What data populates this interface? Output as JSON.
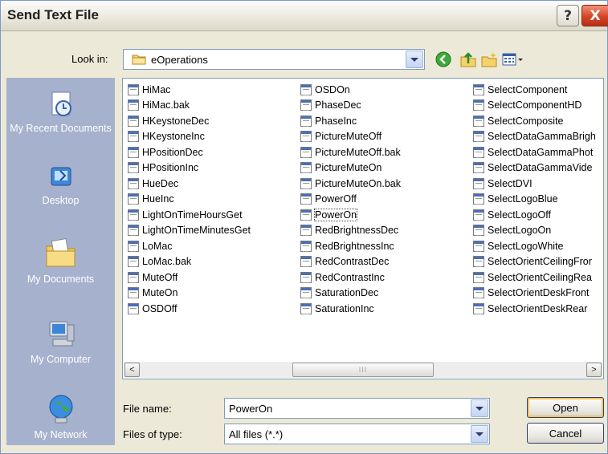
{
  "window": {
    "title": "Send Text File",
    "help_label": "?",
    "close_label": "X"
  },
  "lookin": {
    "label": "Look in:",
    "value": "eOperations"
  },
  "toolbar_icons": [
    "back-icon",
    "up-folder-icon",
    "new-folder-icon",
    "view-menu-icon"
  ],
  "places": [
    {
      "label": "My Recent Documents",
      "icon": "recent-documents-icon"
    },
    {
      "label": "Desktop",
      "icon": "desktop-icon"
    },
    {
      "label": "My Documents",
      "icon": "my-documents-icon"
    },
    {
      "label": "My Computer",
      "icon": "my-computer-icon"
    },
    {
      "label": "My Network",
      "icon": "my-network-icon"
    }
  ],
  "files": {
    "col1": [
      "HiMac",
      "HiMac.bak",
      "HKeystoneDec",
      "HKeystoneInc",
      "HPositionDec",
      "HPositionInc",
      "HueDec",
      "HueInc",
      "LightOnTimeHoursGet",
      "LightOnTimeMinutesGet",
      "LoMac",
      "LoMac.bak",
      "MuteOff",
      "MuteOn",
      "OSDOff"
    ],
    "col2": [
      "OSDOn",
      "PhaseDec",
      "PhaseInc",
      "PictureMuteOff",
      "PictureMuteOff.bak",
      "PictureMuteOn",
      "PictureMuteOn.bak",
      "PowerOff",
      "PowerOn",
      "RedBrightnessDec",
      "RedBrightnessInc",
      "RedContrastDec",
      "RedContrastInc",
      "SaturationDec",
      "SaturationInc"
    ],
    "col3": [
      "SelectComponent",
      "SelectComponentHD",
      "SelectComposite",
      "SelectDataGammaBrigh",
      "SelectDataGammaPhot",
      "SelectDataGammaVide",
      "SelectDVI",
      "SelectLogoBlue",
      "SelectLogoOff",
      "SelectLogoOn",
      "SelectLogoWhite",
      "SelectOrientCeilingFror",
      "SelectOrientCeilingRea",
      "SelectOrientDeskFront",
      "SelectOrientDeskRear"
    ],
    "selected": "PowerOn"
  },
  "scrollbar": {
    "left_arrow": "<",
    "right_arrow": ">",
    "thumb_grip": "III"
  },
  "filename": {
    "label": "File name:",
    "value": "PowerOn"
  },
  "filetype": {
    "label": "Files of type:",
    "value": "All files (*.*)"
  },
  "buttons": {
    "open": "Open",
    "cancel": "Cancel"
  },
  "colors": {
    "places_bg": "#a6b2cd",
    "dialog_bg": "#ece9d8",
    "close_red": "#d3462a",
    "default_btn_ring": "#f3c35f"
  }
}
